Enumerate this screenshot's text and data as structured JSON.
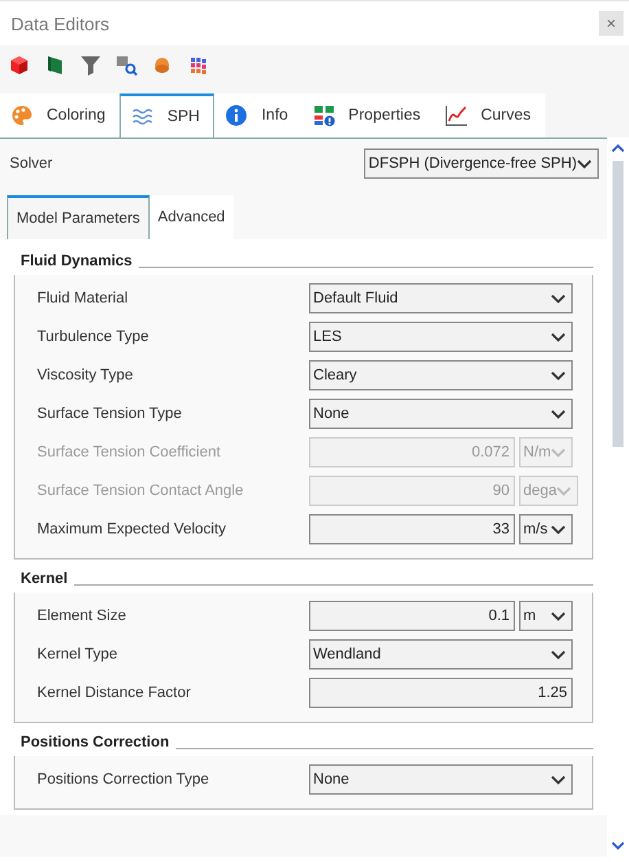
{
  "window": {
    "title": "Data Editors",
    "close": "×"
  },
  "tabs": [
    {
      "label": "Coloring",
      "selected": false
    },
    {
      "label": "SPH",
      "selected": true
    },
    {
      "label": "Info",
      "selected": false
    },
    {
      "label": "Properties",
      "selected": false
    },
    {
      "label": "Curves",
      "selected": false
    }
  ],
  "solver": {
    "label": "Solver",
    "value": "DFSPH (Divergence-free SPH)"
  },
  "subtabs": [
    {
      "label": "Model Parameters",
      "selected": true
    },
    {
      "label": "Advanced",
      "selected": false
    }
  ],
  "sections": [
    {
      "title": "Fluid Dynamics",
      "rows": [
        {
          "label": "Fluid Material",
          "kind": "select",
          "value": "Default Fluid",
          "disabled": false
        },
        {
          "label": "Turbulence Type",
          "kind": "select",
          "value": "LES",
          "disabled": false
        },
        {
          "label": "Viscosity Type",
          "kind": "select",
          "value": "Cleary",
          "disabled": false
        },
        {
          "label": "Surface Tension Type",
          "kind": "select",
          "value": "None",
          "disabled": false
        },
        {
          "label": "Surface Tension Coefficient",
          "kind": "number_unit",
          "value": "0.072",
          "unit": "N/m",
          "disabled": true
        },
        {
          "label": "Surface Tension Contact Angle",
          "kind": "number_unit",
          "value": "90",
          "unit": "dega",
          "disabled": true
        },
        {
          "label": "Maximum Expected Velocity",
          "kind": "number_unit",
          "value": "33",
          "unit": "m/s",
          "disabled": false
        }
      ]
    },
    {
      "title": "Kernel",
      "rows": [
        {
          "label": "Element Size",
          "kind": "number_unit",
          "value": "0.1",
          "unit": "m",
          "disabled": false
        },
        {
          "label": "Kernel Type",
          "kind": "select",
          "value": "Wendland",
          "disabled": false
        },
        {
          "label": "Kernel Distance Factor",
          "kind": "number",
          "value": "1.25",
          "disabled": false
        }
      ]
    },
    {
      "title": "Positions Correction",
      "rows": [
        {
          "label": "Positions Correction Type",
          "kind": "select",
          "value": "None",
          "disabled": false
        }
      ]
    }
  ]
}
